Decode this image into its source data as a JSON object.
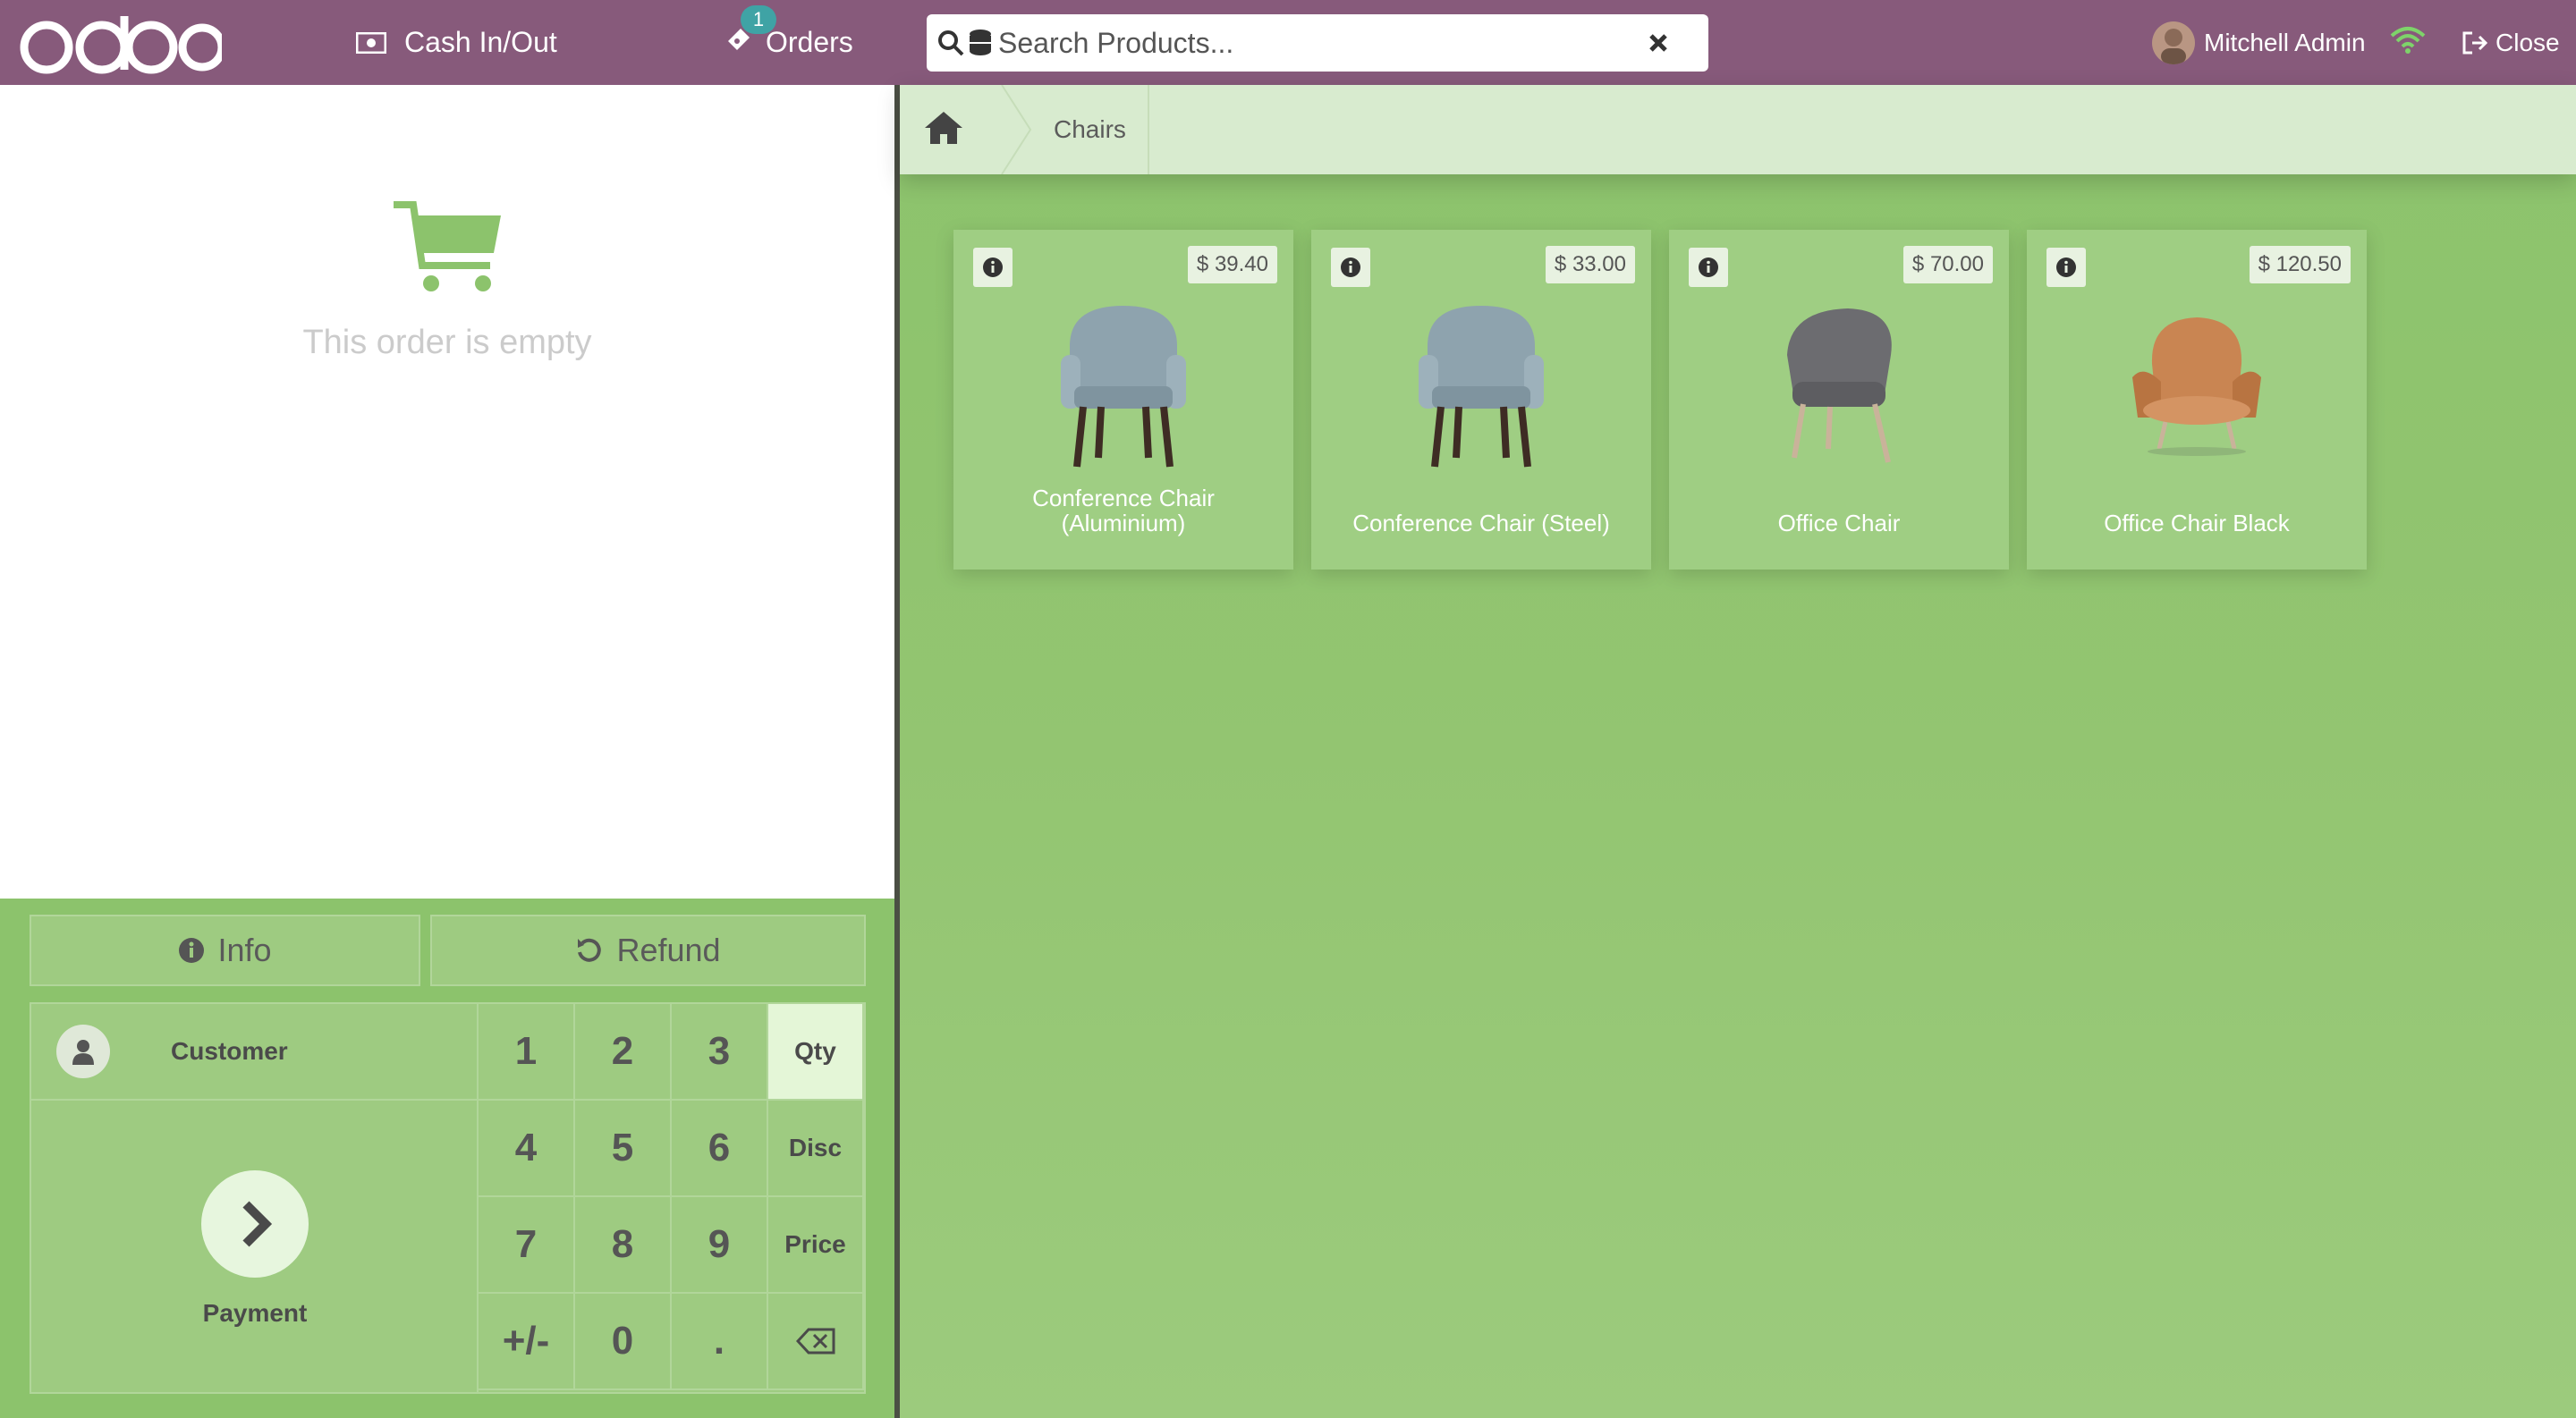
{
  "topbar": {
    "cash_label": "Cash In/Out",
    "orders_label": "Orders",
    "orders_badge": "1",
    "search_placeholder": "Search Products...",
    "user_name": "Mitchell Admin",
    "close_label": "Close",
    "brand_color": "#875a7b"
  },
  "order": {
    "empty_text": "This order is empty"
  },
  "controls": {
    "info_label": "Info",
    "refund_label": "Refund",
    "customer_label": "Customer",
    "payment_label": "Payment",
    "keys": [
      "1",
      "2",
      "3",
      "Qty",
      "4",
      "5",
      "6",
      "Disc",
      "7",
      "8",
      "9",
      "Price",
      "+/-",
      "0",
      "."
    ],
    "active_mode": "Qty"
  },
  "breadcrumb": {
    "category": "Chairs"
  },
  "products": [
    {
      "name": "Conference Chair (Aluminium)",
      "price": "$ 39.40",
      "color": "#8ea3ae"
    },
    {
      "name": "Conference Chair (Steel)",
      "price": "$ 33.00",
      "color": "#8ea3ae"
    },
    {
      "name": "Office Chair",
      "price": "$ 70.00",
      "color": "#6c6c70"
    },
    {
      "name": "Office Chair Black",
      "price": "$ 120.50",
      "color": "#c98552"
    }
  ]
}
